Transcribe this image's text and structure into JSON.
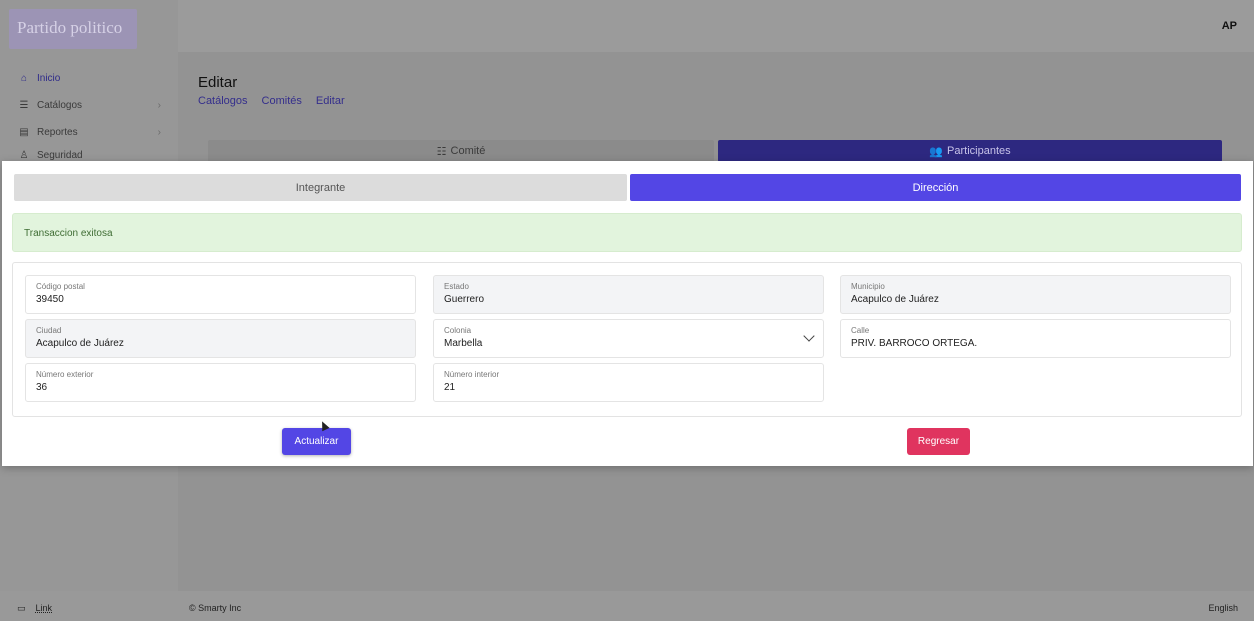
{
  "app": {
    "logo_text": "Partido politico",
    "user_initials": "AP"
  },
  "sidebar": {
    "items": [
      {
        "label": "Inicio",
        "icon": "home-icon",
        "active": true
      },
      {
        "label": "Catálogos",
        "icon": "catalog-icon",
        "has_children": true
      },
      {
        "label": "Reportes",
        "icon": "report-icon",
        "has_children": true
      },
      {
        "label": "Seguridad",
        "icon": "security-icon",
        "has_children": true
      }
    ]
  },
  "page": {
    "title": "Editar",
    "breadcrumb": [
      "Catálogos",
      "Comités",
      "Editar"
    ],
    "tabs": [
      {
        "label": "Comité",
        "icon": "list-icon"
      },
      {
        "label": "Participantes",
        "icon": "users-icon",
        "active": true
      }
    ]
  },
  "modal": {
    "tabs": [
      {
        "label": "Integrante"
      },
      {
        "label": "Dirección",
        "active": true
      }
    ],
    "alert": "Transaccion exitosa",
    "fields": {
      "codigo_postal": {
        "label": "Código postal",
        "value": "39450"
      },
      "estado": {
        "label": "Estado",
        "value": "Guerrero"
      },
      "municipio": {
        "label": "Municipio",
        "value": "Acapulco de Juárez"
      },
      "ciudad": {
        "label": "Ciudad",
        "value": "Acapulco de Juárez"
      },
      "colonia": {
        "label": "Colonia",
        "value": "Marbella"
      },
      "calle": {
        "label": "Calle",
        "value": "PRIV. BARROCO ORTEGA."
      },
      "numero_exterior": {
        "label": "Número exterior",
        "value": "36"
      },
      "numero_interior": {
        "label": "Número interior",
        "value": "21"
      }
    },
    "buttons": {
      "update": "Actualizar",
      "back": "Regresar"
    }
  },
  "footer": {
    "link": "Link",
    "copyright": "© Smarty Inc",
    "language": "English"
  },
  "colors": {
    "primary": "#5346e5",
    "danger": "#e0345f",
    "success_bg": "#e2f4dd"
  }
}
